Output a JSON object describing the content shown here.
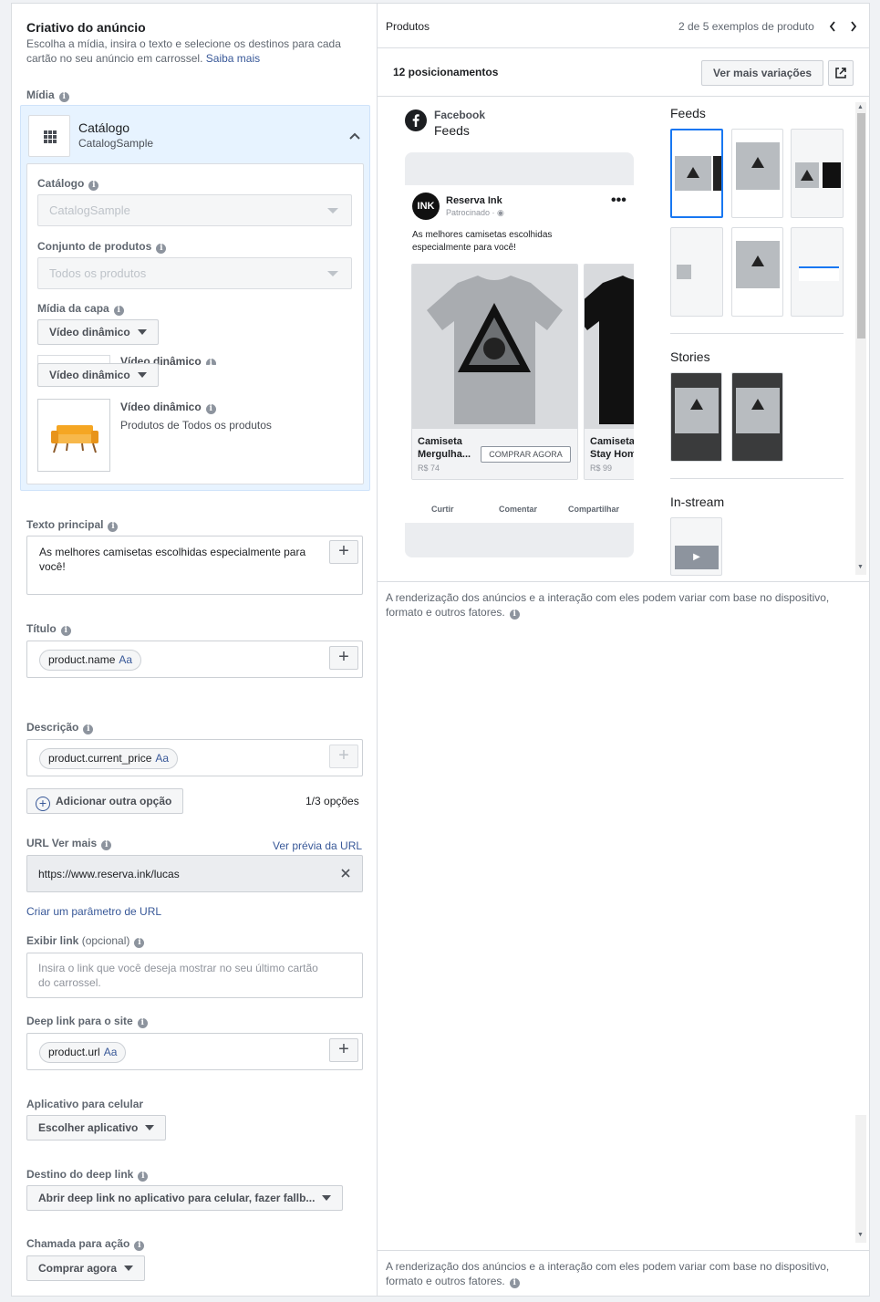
{
  "creative": {
    "title": "Criativo do anúncio",
    "description": "Escolha a mídia, insira o texto e selecione os destinos para cada cartão no seu anúncio em carrossel.",
    "learn_more": "Saiba mais",
    "media_label": "Mídia",
    "catalog_title": "Catálogo",
    "catalog_subtitle": "CatalogSample",
    "catalog_field_label": "Catálogo",
    "catalog_field_value": "CatalogSample",
    "product_set_label": "Conjunto de produtos",
    "product_set_value": "Todos os produtos",
    "cover_media_label": "Mídia da capa",
    "cover_dropdown": "Vídeo dinâmico",
    "cover_dropdown_2": "Vídeo dinâmico",
    "cover_hidden_title": "Vídeo dinâmico",
    "cover_item_title": "Vídeo dinâmico",
    "cover_item_subtitle": "Produtos de Todos os produtos"
  },
  "primary_text": {
    "label": "Texto principal",
    "value": "As melhores camisetas escolhidas especialmente para você!"
  },
  "title_field": {
    "label": "Título",
    "chip": "product.name",
    "chip_suffix": "Aa"
  },
  "description_field": {
    "label": "Descrição",
    "chip": "product.current_price",
    "chip_suffix": "Aa",
    "add_option": "Adicionar outra opção",
    "option_count": "1/3 opções"
  },
  "url": {
    "label": "URL Ver mais",
    "preview_link": "Ver prévia da URL",
    "value": "https://www.reserva.ink/lucas",
    "create_param": "Criar um parâmetro de URL"
  },
  "display_link": {
    "label": "Exibir link",
    "optional": "(opcional)",
    "placeholder": "Insira o link que você deseja mostrar no seu último cartão do carrossel."
  },
  "deep_link": {
    "label": "Deep link para o site",
    "chip": "product.url",
    "chip_suffix": "Aa"
  },
  "mobile_app": {
    "label": "Aplicativo para celular",
    "button": "Escolher aplicativo"
  },
  "deep_link_dest": {
    "label": "Destino do deep link",
    "value": "Abrir deep link no aplicativo para celular, fazer fallb..."
  },
  "cta": {
    "label": "Chamada para ação",
    "value": "Comprar agora"
  },
  "preview": {
    "header": "Produtos",
    "pagination": "2 de 5 exemplos de produto",
    "placements": "12 posicionamentos",
    "more_variations": "Ver mais variações",
    "platform": "Facebook",
    "placement": "Feeds",
    "advertiser": "Reserva Ink",
    "sponsored": "Patrocinado",
    "ad_text": "As melhores camisetas escolhidas especialmente para você!",
    "card1_title_1": "Camiseta",
    "card1_title_2": "Mergulha...",
    "card1_price": "R$ 74",
    "card1_cta": "COMPRAR AGORA",
    "card2_title_1": "Camiseta",
    "card2_title_2": "Stay Hom",
    "card2_price": "R$ 99",
    "action_like": "Curtir",
    "action_comment": "Comentar",
    "action_share": "Compartilhar",
    "logo_text": "INK",
    "sections": {
      "feeds": "Feeds",
      "stories": "Stories",
      "instream": "In-stream"
    },
    "disclaimer": "A renderização dos anúncios e a interação com eles podem variar com base no dispositivo, formato e outros fatores."
  }
}
